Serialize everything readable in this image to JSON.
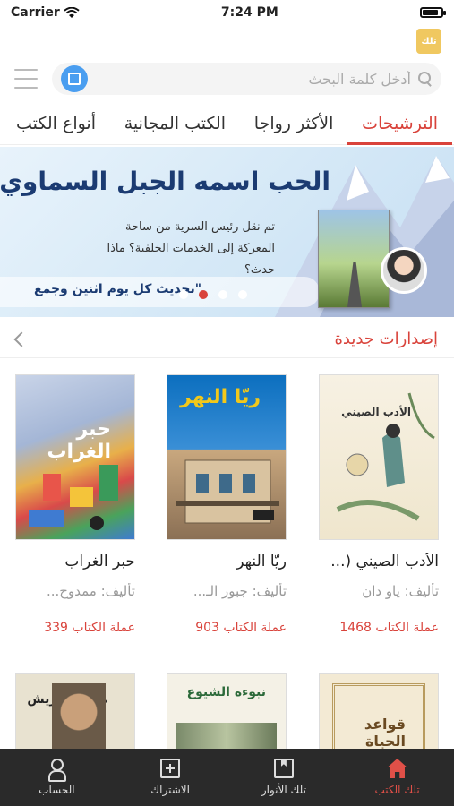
{
  "status_bar": {
    "carrier": "Carrier",
    "time": "7:24 PM",
    "battery_level": 0.85
  },
  "header": {
    "logo_text": "تلك"
  },
  "search": {
    "placeholder": "أدخل كلمة البحث"
  },
  "tabs": [
    {
      "label": "الترشيحات",
      "active": true
    },
    {
      "label": "الأكثر رواجا",
      "active": false
    },
    {
      "label": "الكتب المجانية",
      "active": false
    },
    {
      "label": "أنواع الكتب",
      "active": false
    }
  ],
  "banner": {
    "title": "الحب اسمه الجبل السماوي",
    "description": "تم نقل رئيس السرية من ساحة المعركة إلى الخدمات الخلفية؟ ماذا حدث؟",
    "footer": "\"تحديث كل يوم اثنين وجمع",
    "active_slide": 1,
    "slide_count": 4
  },
  "section": {
    "title": "إصدارات جديدة"
  },
  "books": [
    {
      "title": "الأدب الصيني (...",
      "author": "تأليف: ياو دان",
      "price": "عملة الكتاب 1468",
      "cover_title": "الأدب الصيني"
    },
    {
      "title": "ريّا النهر",
      "author": "تأليف: جبور الـ...",
      "price": "عملة الكتاب 903",
      "cover_title": "ريّا النهر"
    },
    {
      "title": "حبر الغراب",
      "author": "تأليف: ممدوح...",
      "price": "عملة الكتاب 339",
      "cover_title": "حبر الغراب"
    }
  ],
  "books_row2": [
    {
      "cover_title": "قواعد الحياة"
    },
    {
      "cover_title": "نبوءة الشيوع"
    },
    {
      "cover_title": "ماكس فريش"
    }
  ],
  "tabbar": [
    {
      "label": "تلك الكتب",
      "icon": "home-icon",
      "active": true
    },
    {
      "label": "تلك الأنوار",
      "icon": "bookmark-icon",
      "active": false
    },
    {
      "label": "الاشتراك",
      "icon": "plus-box-icon",
      "active": false
    },
    {
      "label": "الحساب",
      "icon": "user-icon",
      "active": false
    }
  ],
  "colors": {
    "accent": "#d9433b",
    "tabbar_bg": "#2a2a2a",
    "scan_button": "#4a9ef0"
  }
}
